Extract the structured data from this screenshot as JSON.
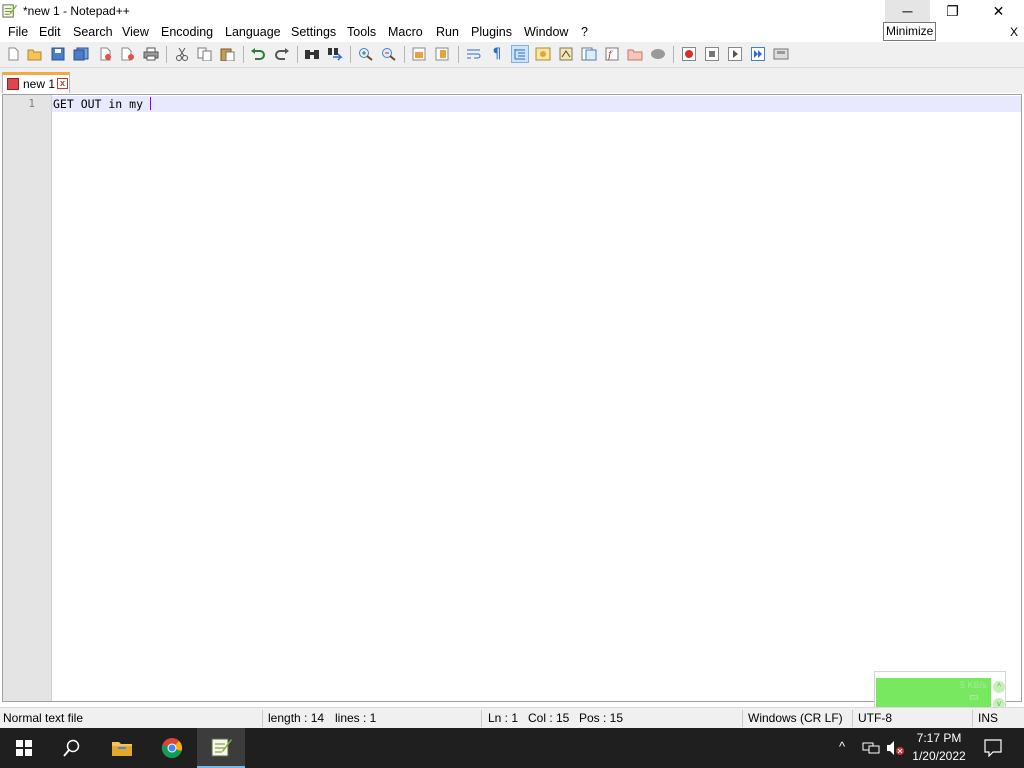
{
  "window": {
    "title": "*new 1 - Notepad++",
    "tooltip": "Minimize",
    "minimize_glyph": "─",
    "maximize_glyph": "❐",
    "close_glyph": "✕"
  },
  "menu": {
    "items": [
      "File",
      "Edit",
      "Search",
      "View",
      "Encoding",
      "Language",
      "Settings",
      "Tools",
      "Macro",
      "Run",
      "Plugins",
      "Window",
      "?"
    ],
    "close_label": "X"
  },
  "toolbar": {
    "icons": [
      "new-file-icon",
      "open-file-icon",
      "save-icon",
      "save-all-icon",
      "close-icon",
      "close-all-icon",
      "print-icon",
      "cut-icon",
      "copy-icon",
      "paste-icon",
      "undo-icon",
      "redo-icon",
      "find-icon",
      "replace-icon",
      "zoom-in-icon",
      "zoom-out-icon",
      "sync-vertical-icon",
      "sync-horizontal-icon",
      "word-wrap-icon",
      "show-all-chars-icon",
      "indent-guide-icon",
      "user-defined-language-icon",
      "document-map-icon",
      "document-list-icon",
      "function-list-icon",
      "folder-as-workspace-icon",
      "monitoring-icon",
      "record-macro-icon",
      "stop-recording-icon",
      "play-macro-icon",
      "run-macro-multiple-icon",
      "save-macro-icon"
    ]
  },
  "tabs": [
    {
      "label": "new 1",
      "close_glyph": "x"
    }
  ],
  "editor": {
    "line_numbers": [
      "1"
    ],
    "lines": [
      "GET OUT in my "
    ]
  },
  "notification": {
    "text": "5 KB/s",
    "up_glyph": "^",
    "down_glyph": "v"
  },
  "statusbar": {
    "file_type": "Normal text file",
    "length": "length : 14",
    "lines": "lines : 1",
    "ln": "Ln : 1",
    "col": "Col : 15",
    "pos": "Pos : 15",
    "eol": "Windows (CR LF)",
    "encoding": "UTF-8",
    "mode": "INS"
  },
  "taskbar": {
    "apps": [
      "start-icon",
      "search-icon",
      "file-explorer-icon",
      "chrome-icon",
      "notepad-plus-plus-icon"
    ],
    "time": "7:17 PM",
    "date": "1/20/2022"
  },
  "colors": {
    "tab_accent": "#f4a742",
    "current_line": "#e8e8ff",
    "caret": "#8000ff",
    "taskbar": "#1f1f1f",
    "notification_fill": "#79e861"
  }
}
